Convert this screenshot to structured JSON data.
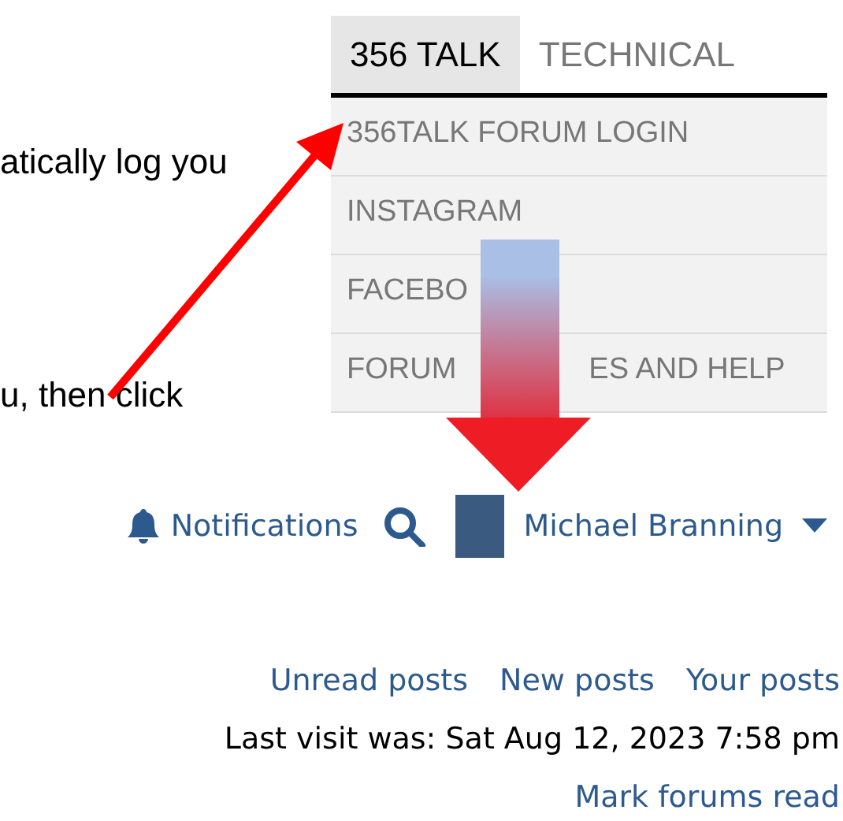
{
  "annotation_text": [
    "atically log you",
    "u, then click"
  ],
  "tabs": [
    {
      "label": "356 TALK",
      "selected": true
    },
    {
      "label": "TECHNICAL",
      "selected": false
    }
  ],
  "menu_items": [
    {
      "parts": [
        "356TALK FORUM LOGIN"
      ]
    },
    {
      "parts": [
        "INSTAGRAM"
      ]
    },
    {
      "parts": [
        "FACEBO"
      ]
    },
    {
      "parts": [
        "FORUM",
        "ES AND HELP"
      ]
    }
  ],
  "user_bar": {
    "notifications": "Notifications",
    "user_name": "Michael Branning"
  },
  "quick_links": [
    "Unread posts",
    "New posts",
    "Your posts"
  ],
  "last_visit": "Last visit was: Sat Aug 12, 2023 7:58 pm",
  "mark_read": "Mark forums read"
}
